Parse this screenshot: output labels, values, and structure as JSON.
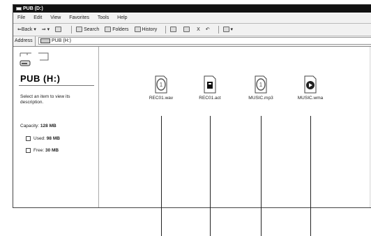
{
  "window": {
    "title": "PUB (D:)"
  },
  "menu": [
    "File",
    "Edit",
    "View",
    "Favorites",
    "Tools",
    "Help"
  ],
  "toolbar": {
    "back": "Back",
    "forward_arrow": "⇒",
    "search": "Search",
    "folders": "Folders",
    "history": "History",
    "delete_glyph": "X",
    "undo_glyph": "↶"
  },
  "address": {
    "label": "Address",
    "value": "PUB (H:)"
  },
  "leftpane": {
    "drive_title": "PUB (H:)",
    "description": "Select an item to view its description.",
    "capacity_label": "Capacity:",
    "capacity_value": "128 MB",
    "used_label": "Used:",
    "used_value": "98 MB",
    "free_label": "Free:",
    "free_value": "30 MB"
  },
  "files": [
    {
      "name": "REC01.wav",
      "icon": "audio-file-icon"
    },
    {
      "name": "REC01.act",
      "icon": "act-file-icon"
    },
    {
      "name": "MUSIC.mp3",
      "icon": "audio-file-icon"
    },
    {
      "name": "MUSIC.wma",
      "icon": "media-player-file-icon"
    }
  ]
}
